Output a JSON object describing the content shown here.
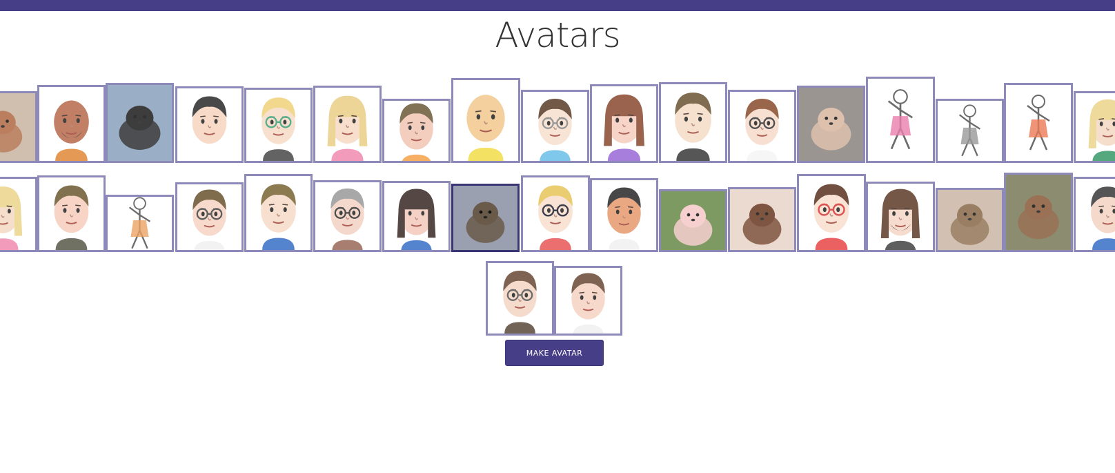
{
  "header": {
    "title": "Avatars"
  },
  "colors": {
    "accent": "#463f87",
    "tile_border": "#7b76ad",
    "selected_border": "#3a3573"
  },
  "avatars": [
    {
      "id": "deer",
      "kind": "animal",
      "label": "Deer photo"
    },
    {
      "id": "mii-bald-beard",
      "kind": "mii",
      "label": "Mii bald beard"
    },
    {
      "id": "panda",
      "kind": "animal",
      "label": "Panda photo"
    },
    {
      "id": "mii-black-hair",
      "kind": "mii",
      "label": "Mii black hair"
    },
    {
      "id": "mii-blonde-boy",
      "kind": "mii",
      "label": "Mii blonde boy"
    },
    {
      "id": "mii-blonde-woman",
      "kind": "mii",
      "label": "Mii blonde woman"
    },
    {
      "id": "mii-old-man",
      "kind": "mii",
      "label": "Mii old man"
    },
    {
      "id": "mii-bald-yellow",
      "kind": "mii",
      "label": "Mii bald yellow"
    },
    {
      "id": "mii-man-glasses",
      "kind": "mii",
      "label": "Mii man glasses"
    },
    {
      "id": "mii-woman-brown",
      "kind": "mii",
      "label": "Mii woman brown"
    },
    {
      "id": "mii-long-chin",
      "kind": "mii",
      "label": "Mii long chin"
    },
    {
      "id": "mii-big-glasses",
      "kind": "mii",
      "label": "Mii big glasses"
    },
    {
      "id": "kitten",
      "kind": "animal",
      "label": "Kitten photo"
    },
    {
      "id": "dancing-lady",
      "kind": "drawing",
      "label": "Dancing lady illustration"
    },
    {
      "id": "sketch-dog",
      "kind": "drawing",
      "label": "Dog sketch"
    },
    {
      "id": "dancing-girl",
      "kind": "drawing",
      "label": "Dancing girl illustration"
    },
    {
      "id": "mii-blonde-edge",
      "kind": "mii",
      "label": "Mii blonde partial"
    },
    {
      "id": "mii-blonde-edge-2",
      "kind": "mii",
      "label": "Mii blonde partial"
    },
    {
      "id": "mii-freckles",
      "kind": "mii",
      "label": "Mii freckles"
    },
    {
      "id": "cartoon-kid",
      "kind": "drawing",
      "label": "Cartoon kid"
    },
    {
      "id": "mii-square-glasses",
      "kind": "mii",
      "label": "Mii square glasses"
    },
    {
      "id": "mii-blue-shirt",
      "kind": "mii",
      "label": "Mii blue shirt"
    },
    {
      "id": "mii-grey-glasses",
      "kind": "mii",
      "label": "Mii grey glasses"
    },
    {
      "id": "mii-long-hair",
      "kind": "mii",
      "label": "Mii long hair"
    },
    {
      "id": "hedgehog",
      "kind": "animal",
      "label": "Hedgehog photo"
    },
    {
      "id": "mii-mask",
      "kind": "mii",
      "label": "Mii mask"
    },
    {
      "id": "mii-tan",
      "kind": "mii",
      "label": "Mii tan"
    },
    {
      "id": "piglet",
      "kind": "animal",
      "label": "Piglet photo"
    },
    {
      "id": "puppy",
      "kind": "animal",
      "label": "Puppy photo"
    },
    {
      "id": "mii-red-glasses",
      "kind": "mii",
      "label": "Mii red glasses"
    },
    {
      "id": "mii-goatee",
      "kind": "mii",
      "label": "Mii goatee"
    },
    {
      "id": "sloth",
      "kind": "animal",
      "label": "Sloth photo"
    },
    {
      "id": "horse",
      "kind": "animal",
      "label": "Horse photo"
    },
    {
      "id": "mii-spiky",
      "kind": "mii",
      "label": "Mii spiky hair"
    },
    {
      "id": "mii-glasses-bob",
      "kind": "mii",
      "label": "Mii glasses bob"
    },
    {
      "id": "mii-brown-bowl",
      "kind": "mii",
      "label": "Mii brown bowl cut"
    }
  ],
  "selected_avatar": "hedgehog",
  "actions": {
    "make_avatar_label": "MAKE AVATAR"
  }
}
